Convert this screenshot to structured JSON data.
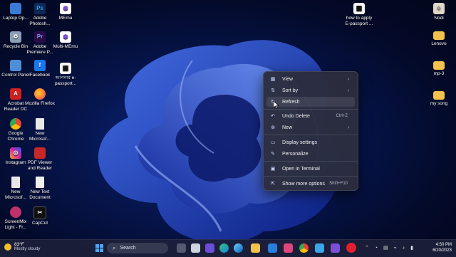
{
  "desktop_icons_left": [
    {
      "label": "Laptop Op...",
      "icon": "monitor-icon",
      "color": "#3a7bd5"
    },
    {
      "label": "Recycle Bin",
      "icon": "recycle-bin-icon",
      "color": "#8aa0b8"
    },
    {
      "label": "Control Panel",
      "icon": "control-panel-icon",
      "color": "#4c8fd8"
    },
    {
      "label": "Acrobat Reader DC",
      "icon": "acrobat-icon",
      "color": "#d21f1f"
    },
    {
      "label": "Google Chrome",
      "icon": "chrome-icon",
      "color": "#34a853"
    },
    {
      "label": "Instagram",
      "icon": "instagram-icon",
      "color": "#d6249f"
    },
    {
      "label": "New Microsof...",
      "icon": "document-icon",
      "color": "#e8e8e8"
    },
    {
      "label": "ScreenMix Light - Fr...",
      "icon": "screenmix-icon",
      "color": "#c0306a"
    }
  ],
  "desktop_icons_col2": [
    {
      "label": "Adobe Photosh...",
      "icon": "photoshop-icon",
      "color": "#0b2a5a",
      "glyph": "Ps"
    },
    {
      "label": "Adobe Premiere P...",
      "icon": "premiere-icon",
      "color": "#2a0b4a",
      "glyph": "Pr"
    },
    {
      "label": "Facebook",
      "icon": "facebook-icon",
      "color": "#1877f2",
      "glyph": "f"
    },
    {
      "label": "Mozilla Firefox",
      "icon": "firefox-icon",
      "color": "#ff7139",
      "glyph": ""
    },
    {
      "label": "New Microsof...",
      "icon": "document-icon",
      "color": "#e8e8e8",
      "glyph": ""
    },
    {
      "label": "PDF Viewer and Reader",
      "icon": "pdf-icon",
      "color": "#c62828",
      "glyph": ""
    },
    {
      "label": "New Text Document",
      "icon": "text-document-icon",
      "color": "#f0f0f0",
      "glyph": ""
    },
    {
      "label": "CapCut",
      "icon": "capcut-icon",
      "color": "#111111",
      "glyph": ""
    }
  ],
  "desktop_icons_col3": [
    {
      "label": "MEmu",
      "icon": "memu-icon",
      "color": "#7b4fd6"
    },
    {
      "label": "Multi-MEmu",
      "icon": "multi-memu-icon",
      "color": "#7b4fd6"
    },
    {
      "label": "আপনার e-passport...",
      "icon": "qr-icon",
      "color": "#f5f5f5"
    }
  ],
  "desktop_icons_right": [
    {
      "label": "how to apply E-passport ...",
      "icon": "qr-icon",
      "color": "#f5f5f5"
    },
    {
      "label": "Nodi",
      "icon": "user-icon",
      "color": "#dfd6c8"
    },
    {
      "label": "Lenovo",
      "icon": "folder-icon",
      "color": "#f2c14e"
    },
    {
      "label": "mp-3",
      "icon": "folder-icon",
      "color": "#f2c14e"
    },
    {
      "label": "my song",
      "icon": "folder-icon",
      "color": "#f2c14e"
    }
  ],
  "context_menu": {
    "items": [
      {
        "label": "View",
        "icon": "grid-icon",
        "glyph": "▦",
        "submenu": true,
        "shortcut": ""
      },
      {
        "label": "Sort by",
        "icon": "sort-icon",
        "glyph": "⇅",
        "submenu": true,
        "shortcut": ""
      },
      {
        "label": "Refresh",
        "icon": "refresh-icon",
        "glyph": "↻",
        "submenu": false,
        "shortcut": ""
      },
      {
        "label": "Undo Delete",
        "icon": "undo-icon",
        "glyph": "↶",
        "submenu": false,
        "shortcut": "Ctrl+Z"
      },
      {
        "label": "New",
        "icon": "new-icon",
        "glyph": "⊕",
        "submenu": true,
        "shortcut": ""
      },
      {
        "label": "Display settings",
        "icon": "display-icon",
        "glyph": "▭",
        "submenu": false,
        "shortcut": ""
      },
      {
        "label": "Personalize",
        "icon": "brush-icon",
        "glyph": "✎",
        "submenu": false,
        "shortcut": ""
      },
      {
        "label": "Open in Terminal",
        "icon": "terminal-icon",
        "glyph": "▣",
        "submenu": false,
        "shortcut": ""
      },
      {
        "label": "Show more options",
        "icon": "more-options-icon",
        "glyph": "⇱",
        "submenu": false,
        "shortcut": "Shift+F10"
      }
    ],
    "hovered": "Refresh"
  },
  "taskbar": {
    "weather_temp": "83°F",
    "weather_desc": "Mostly cloudy",
    "search_placeholder": "Search",
    "time": "4:50 PM",
    "date": "6/20/2023"
  },
  "colors": {
    "accent": "#3a66ff",
    "menu_bg": "#2c2e3e"
  }
}
